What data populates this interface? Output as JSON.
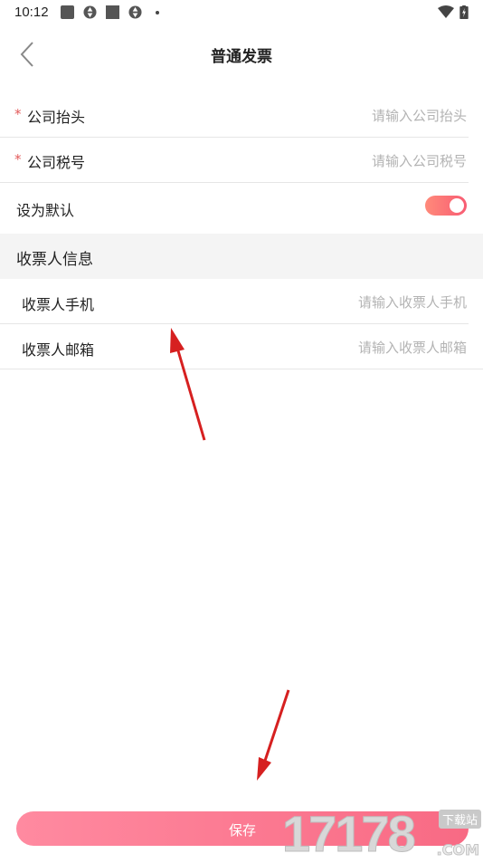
{
  "status_bar": {
    "time": "10:12"
  },
  "nav": {
    "title": "普通发票"
  },
  "form": {
    "company_title": {
      "required_mark": "*",
      "label": "公司抬头",
      "placeholder": "请输入公司抬头"
    },
    "tax_number": {
      "required_mark": "*",
      "label": "公司税号",
      "placeholder": "请输入公司税号"
    },
    "set_default": {
      "label": "设为默认",
      "enabled": true
    }
  },
  "recipient_section": {
    "title": "收票人信息",
    "phone": {
      "label": "收票人手机",
      "placeholder": "请输入收票人手机"
    },
    "email": {
      "label": "收票人邮箱",
      "placeholder": "请输入收票人邮箱"
    }
  },
  "save_button": {
    "label": "保存"
  },
  "watermark": {
    "digits": "17178",
    "suffix": ".COM",
    "tag": "下载站"
  },
  "colors": {
    "accent": "#f86a84",
    "toggle": "#f85c73",
    "required": "#e25a5a",
    "annotation_arrow": "#d62020"
  }
}
